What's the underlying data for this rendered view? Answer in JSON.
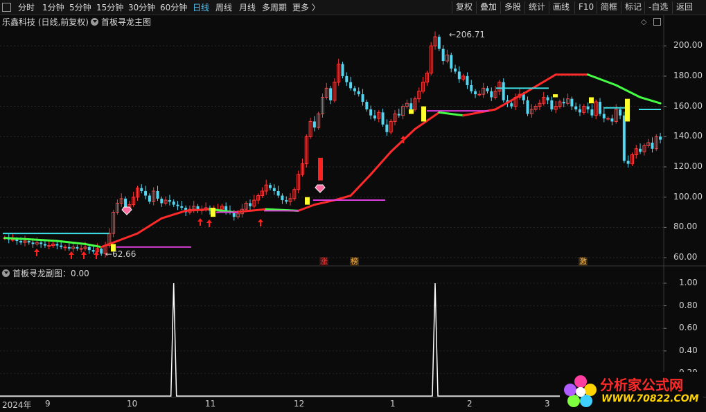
{
  "toolbar": {
    "periods": [
      "分时",
      "1分钟",
      "5分钟",
      "15分钟",
      "30分钟",
      "60分钟",
      "日线",
      "周线",
      "月线",
      "多周期",
      "更多 〉"
    ],
    "active_period": "日线",
    "right_buttons": [
      "复权",
      "叠加",
      "多股",
      "统计",
      "画线",
      "F10",
      "简框",
      "标记",
      "-自选",
      "返回"
    ]
  },
  "main_chart": {
    "stock_title": "乐鑫科技 (日线,前复权)",
    "indicator_name": "首板寻龙主图",
    "high_label": "206.71",
    "low_label": "62.66"
  },
  "sub_chart": {
    "indicator_label": "首板寻龙副图：0.00"
  },
  "events": [
    {
      "label": "涨",
      "color": "#ff3b3b"
    },
    {
      "label": "榜",
      "color": "#ffb43b"
    },
    {
      "label": "激",
      "color": "#ffb43b"
    }
  ],
  "bottom_axis": {
    "year_label": "2024年",
    "month_labels": [
      "9",
      "10",
      "11",
      "12",
      "1",
      "2",
      "3"
    ]
  },
  "watermark": {
    "title": "分析家公式网",
    "url": "WWW.70822.COM"
  },
  "chart_data": [
    {
      "type": "candlestick",
      "title": "首板寻龙主图",
      "y_ticks": [
        60,
        80,
        100,
        120,
        140,
        160,
        180,
        200
      ],
      "y_tick_labels": [
        "60.00",
        "80.00",
        "100.00",
        "120.00",
        "140.00",
        "160.00",
        "180.00",
        "200.00"
      ],
      "ylim": [
        55,
        212
      ],
      "price_max": 206.71,
      "price_min": 62.66,
      "trend_line": {
        "x": [
          0,
          8,
          16,
          24,
          30,
          40,
          48,
          55,
          62,
          70,
          80,
          90,
          95,
          100,
          105,
          112,
          118,
          125,
          132,
          140,
          150,
          160,
          168,
          178,
          186,
          194,
          200
        ],
        "y": [
          73,
          72,
          71,
          69,
          67,
          76,
          86,
          91,
          92,
          90,
          92,
          91,
          95,
          98,
          101,
          115,
          130,
          145,
          156,
          154,
          158,
          170,
          181,
          181,
          174,
          166,
          162
        ],
        "rising_color": "#ff2a2a",
        "falling_color": "#44ff44"
      },
      "close": [
        73,
        72,
        72,
        71,
        70,
        71,
        70,
        69,
        70,
        69,
        68,
        68,
        69,
        68,
        67,
        67,
        66,
        67,
        66,
        66,
        67,
        65,
        64,
        66,
        62.66,
        68,
        76,
        90,
        96,
        99,
        92,
        95,
        100,
        106,
        104,
        101,
        97,
        104,
        99,
        96,
        98,
        97,
        95,
        94,
        93,
        90,
        92,
        94,
        91,
        92,
        93,
        91,
        92,
        92,
        94,
        91,
        90,
        87,
        89,
        92,
        96,
        94,
        98,
        101,
        104,
        108,
        106,
        104,
        101,
        98,
        97,
        99,
        105,
        115,
        122,
        140,
        150,
        146,
        155,
        166,
        172,
        164,
        176,
        188,
        180,
        176,
        172,
        170,
        168,
        163,
        158,
        154,
        152,
        156,
        148,
        143,
        150,
        155,
        154,
        160,
        162,
        158,
        165,
        170,
        176,
        182,
        200,
        206,
        198,
        190,
        194,
        185,
        183,
        178,
        180,
        174,
        170,
        168,
        168,
        172,
        170,
        166,
        170,
        176,
        164,
        162,
        160,
        166,
        168,
        164,
        155,
        158,
        160,
        162,
        166,
        164,
        158,
        160,
        163,
        162,
        165,
        160,
        158,
        156,
        160,
        158,
        154,
        163,
        155,
        152,
        152,
        150,
        158,
        154,
        124,
        122,
        128,
        132,
        130,
        134,
        136,
        132,
        140,
        138
      ],
      "sub_panel": {
        "y_ticks": [
          0.0,
          0.2,
          0.4,
          0.6,
          0.8,
          1.0
        ],
        "y_tick_labels": [
          "0.20",
          "0.40",
          "0.60",
          "0.80",
          "1.00"
        ],
        "signals": [
          {
            "x_index": 42,
            "value": 1.0
          },
          {
            "x_index": 107,
            "value": 1.0
          }
        ],
        "current_value": 0.0
      }
    }
  ]
}
